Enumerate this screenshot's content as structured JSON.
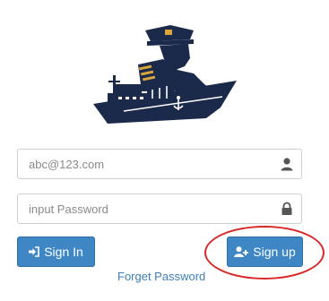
{
  "login": {
    "email_placeholder": "abc@123.com",
    "password_placeholder": "input Password",
    "signin_label": "Sign In",
    "signup_label": "Sign up",
    "forget_label": "Forget Password"
  },
  "icons": {
    "email_field": "user-icon",
    "password_field": "lock-icon",
    "signin_button": "sign-in-icon",
    "signup_button": "user-plus-icon"
  },
  "colors": {
    "primary_button": "#3e87c4",
    "link": "#3e7fbd",
    "highlight": "#d8282a",
    "logo": "#1b2a4a",
    "logo_accent": "#d9a53c"
  }
}
